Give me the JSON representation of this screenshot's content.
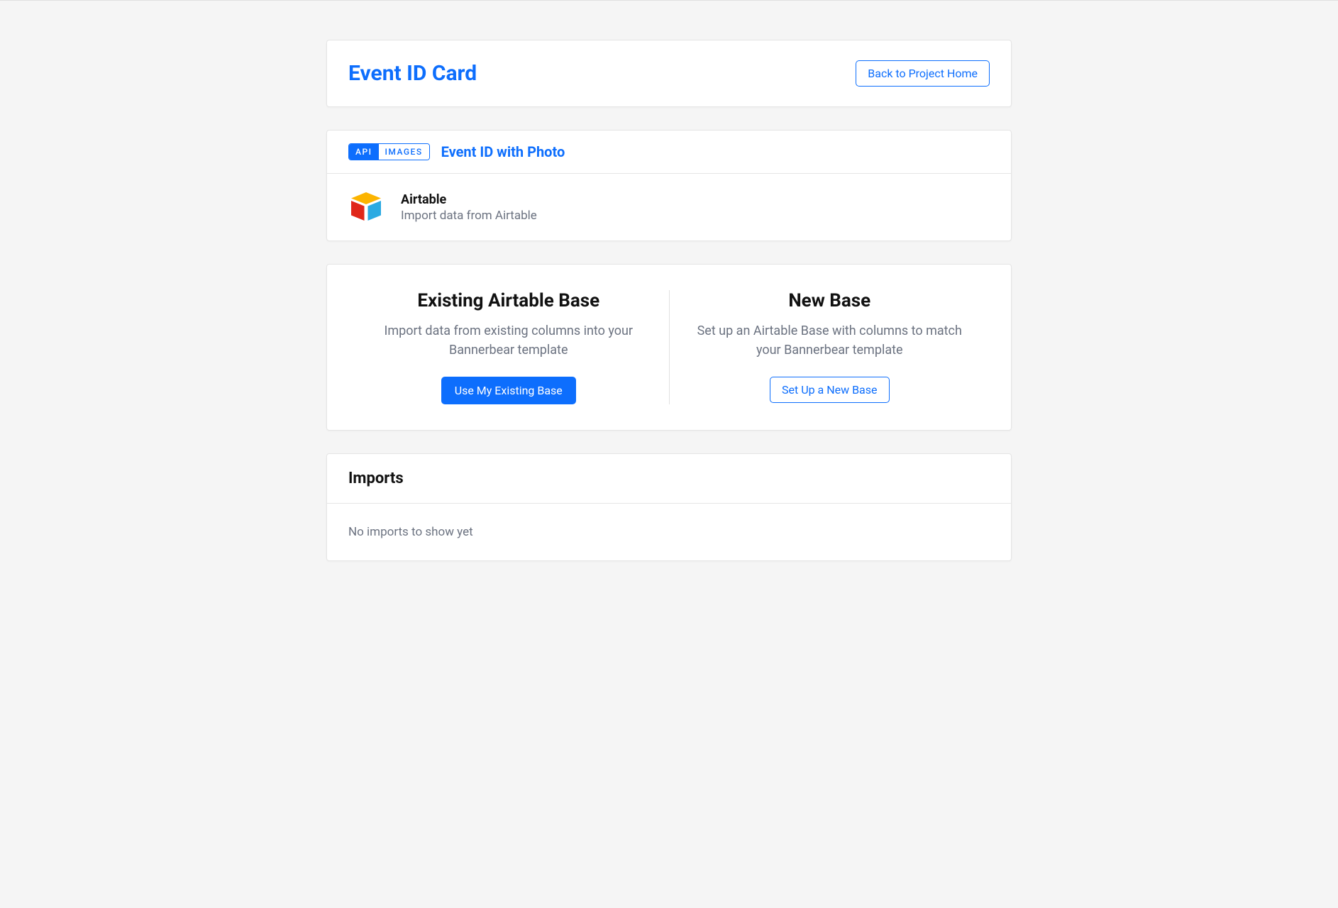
{
  "header": {
    "title": "Event ID Card",
    "back_button": "Back to Project Home"
  },
  "meta": {
    "pill_api": "API",
    "pill_images": "IMAGES",
    "template_name": "Event ID with Photo",
    "integration_name": "Airtable",
    "integration_desc": "Import data from Airtable"
  },
  "options": {
    "existing": {
      "title": "Existing Airtable Base",
      "desc": "Import data from existing columns into your Bannerbear template",
      "button": "Use My Existing Base"
    },
    "new": {
      "title": "New Base",
      "desc": "Set up an Airtable Base with columns to match your Bannerbear template",
      "button": "Set Up a New Base"
    }
  },
  "imports": {
    "heading": "Imports",
    "empty_state": "No imports to show yet"
  }
}
